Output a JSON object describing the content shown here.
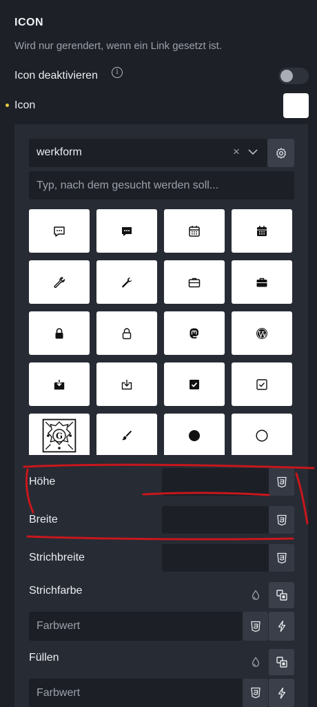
{
  "section": {
    "title": "ICON",
    "description": "Wird nur gerendert, wenn ein Link gesetzt ist."
  },
  "disable_icon": {
    "label": "Icon deaktivieren",
    "info_glyph": "i",
    "checked": false
  },
  "icon_row": {
    "label": "Icon",
    "swatch_color": "#ffffff"
  },
  "icon_picker": {
    "library_value": "werkform",
    "clear_glyph": "×",
    "search_placeholder": "Typ, nach dem gesucht werden soll...",
    "icons": [
      "comment-outline-icon",
      "comment-solid-icon",
      "calendar-outline-icon",
      "calendar-solid-icon",
      "wrench-outline-icon",
      "wrench-solid-icon",
      "briefcase-outline-icon",
      "briefcase-solid-icon",
      "lock-solid-icon",
      "lock-outline-icon",
      "mastodon-icon",
      "wordpress-icon",
      "download-box-solid-icon",
      "download-box-outline-icon",
      "checkbox-checked-solid-icon",
      "checkbox-checked-outline-icon",
      "ornate-emblem-icon",
      "brush-icon",
      "circle-solid-icon",
      "circle-outline-icon"
    ]
  },
  "controls": {
    "height_label": "Höhe",
    "width_label": "Breite",
    "stroke_width_label": "Strichbreite",
    "stroke_color_label": "Strichfarbe",
    "stroke_color_placeholder": "Farbwert",
    "fill_label": "Füllen",
    "fill_placeholder": "Farbwert"
  },
  "colors": {
    "background": "#1d2027",
    "panel": "#272b34",
    "input": "#1c1f26",
    "accent_dot": "#e8c93b",
    "annotation": "#c8171c"
  }
}
